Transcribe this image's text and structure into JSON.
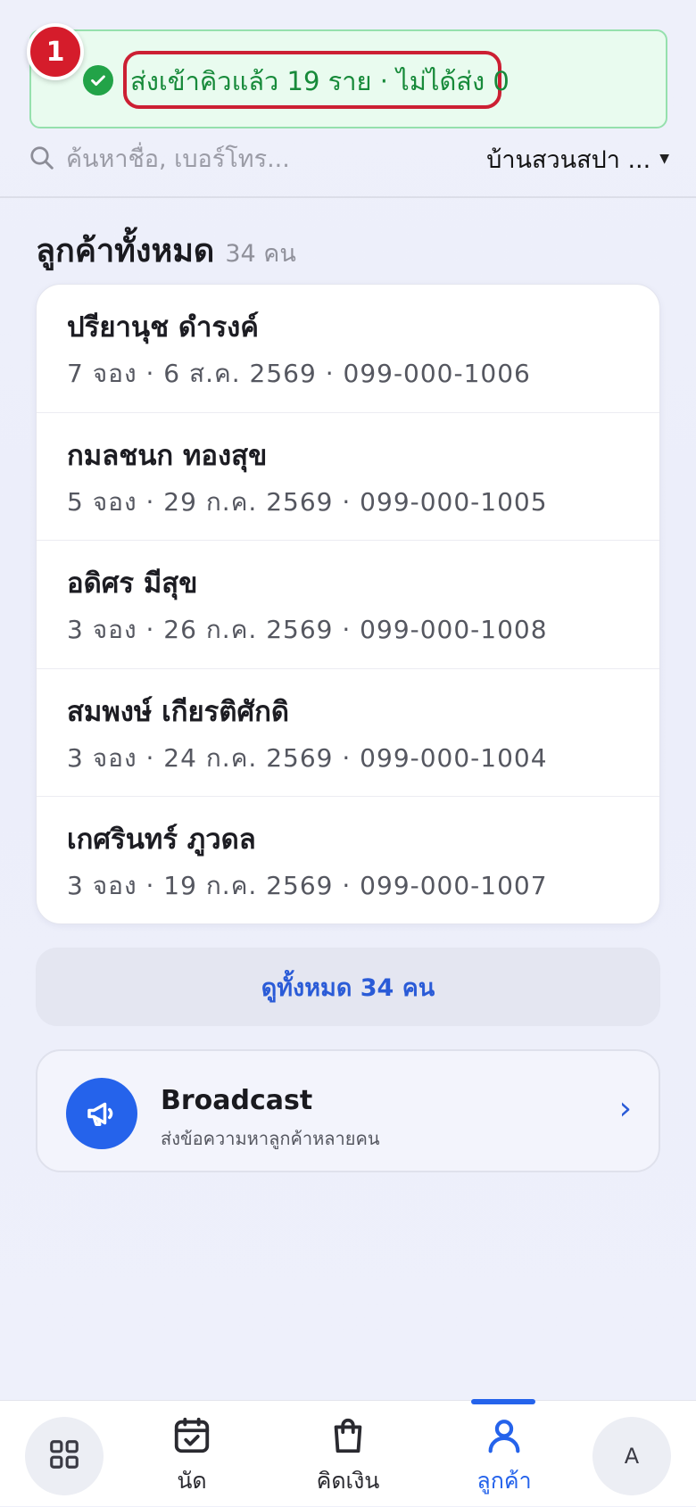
{
  "toast": {
    "step_number": "1",
    "message": "ส่งเข้าคิวแล้ว 19 ราย · ไม่ได้ส่ง 0",
    "color": "#178a3a"
  },
  "search": {
    "placeholder": "ค้นหาชื่อ, เบอร์โทร...",
    "branch": "บ้านสวนสปา ..."
  },
  "section": {
    "title": "ลูกค้าทั้งหมด",
    "count": "34 คน"
  },
  "customers": [
    {
      "name": "ปรียานุช ดำรงค์",
      "meta": "7 จอง · 6 ส.ค. 2569 · 099-000-1006"
    },
    {
      "name": "กมลชนก ทองสุข",
      "meta": "5 จอง · 29 ก.ค. 2569 · 099-000-1005"
    },
    {
      "name": "อดิศร มีสุข",
      "meta": "3 จอง · 26 ก.ค. 2569 · 099-000-1008"
    },
    {
      "name": "สมพงษ์ เกียรติศักดิ",
      "meta": "3 จอง · 24 ก.ค. 2569 · 099-000-1004"
    },
    {
      "name": "เกศรินทร์ ภูวดล",
      "meta": "3 จอง · 19 ก.ค. 2569 · 099-000-1007"
    }
  ],
  "view_all_label": "ดูทั้งหมด 34 คน",
  "broadcast": {
    "title": "Broadcast",
    "subtitle": "ส่งข้อความหาลูกค้าหลายคน",
    "icon": "megaphone-icon"
  },
  "nav": {
    "items": [
      {
        "label": "นัด",
        "icon": "calendar-check-icon"
      },
      {
        "label": "คิดเงิน",
        "icon": "shopping-bag-icon"
      },
      {
        "label": "ลูกค้า",
        "icon": "user-icon",
        "active": true
      }
    ],
    "grid_icon": "grid-icon",
    "avatar_letter": "A",
    "active_color": "#2563eb"
  }
}
